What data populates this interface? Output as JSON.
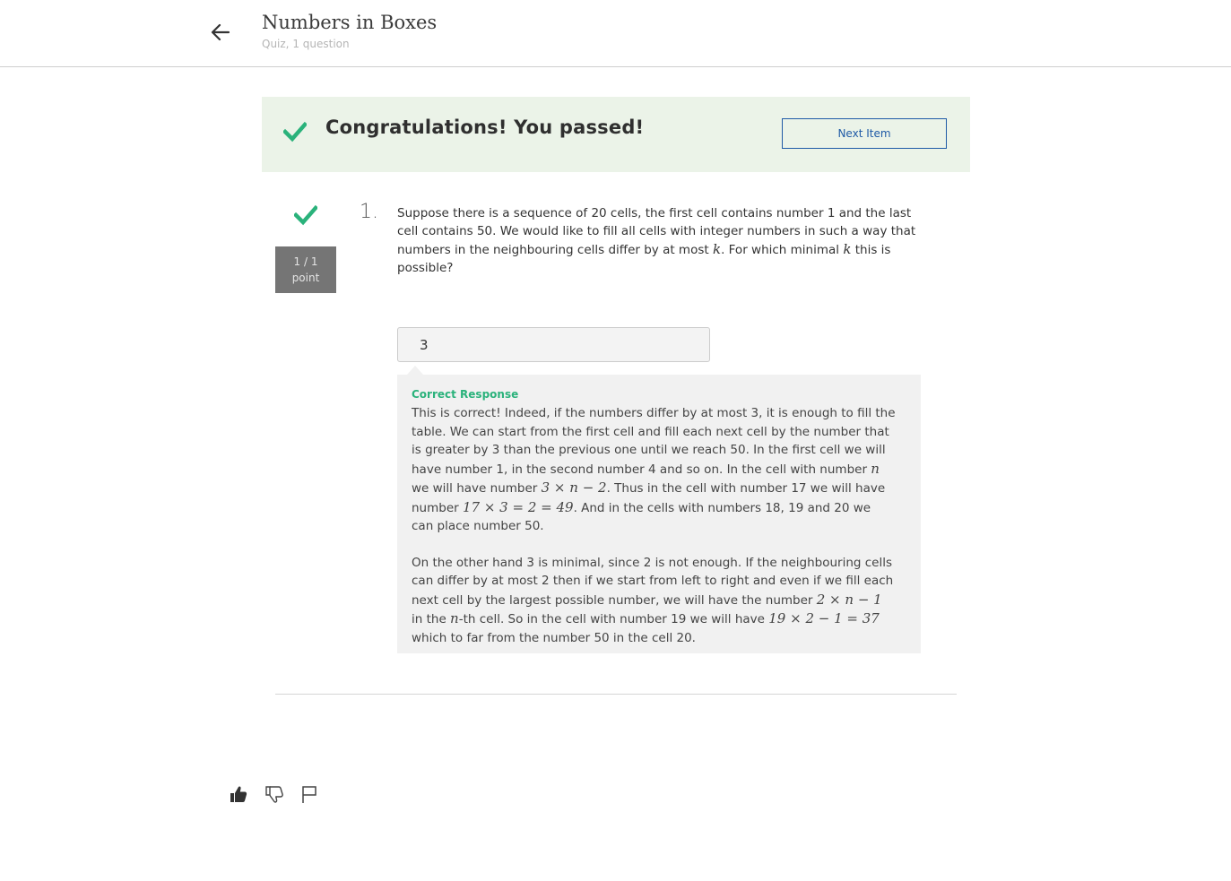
{
  "header": {
    "back_icon": "arrow-left-icon",
    "title": "Numbers in Boxes",
    "subtitle": "Quiz, 1 question"
  },
  "banner": {
    "icon": "check-icon",
    "message": "Congratulations! You passed!",
    "next_label": "Next Item",
    "background_color": "#ebf3e8",
    "check_color": "#2ab27b"
  },
  "question": {
    "status_icon": "check-icon",
    "points_score": "1 / 1",
    "points_unit": "point",
    "number": "1.",
    "text_part1": "Suppose there is a sequence of 20 cells, the first cell contains number 1 and the last cell contains 50. We would like to fill all cells with integer numbers in such a way that numbers in the neighbouring cells differ by at most ",
    "var_k": "k",
    "text_part2": ". For which minimal ",
    "text_part3": " this is possible?",
    "answer_value": "3"
  },
  "feedback": {
    "label": "Correct Response",
    "p1_a": "This is correct! Indeed, if the numbers differ by at most 3, it is enough to fill the table. We can start from the first cell and fill each next cell by the number that is greater by 3 than the previous one until we reach 50. In the first cell we will have number 1, in the second number 4 and so on. In the cell with number ",
    "p1_n": "n",
    "p1_b": " we will have number ",
    "p1_math1": "3 × n − 2",
    "p1_c": ". Thus in the cell with number 17 we will have number ",
    "p1_math2": "17 × 3 = 2 = 49",
    "p1_d": ". And in the cells with numbers 18, 19 and 20 we can place number 50.",
    "p2_a": "On the other hand 3 is minimal, since 2 is not enough. If the neighbouring cells can differ by at most 2 then if we start from left to right and even if we fill each next cell by the largest possible number, we will have the number ",
    "p2_math1": "2 × n − 1",
    "p2_b": " in the ",
    "p2_n": "n",
    "p2_c": "-th cell. So in the cell with number 19 we will have ",
    "p2_math2": "19 × 2 − 1 = 37",
    "p2_d": " which to far from the number 50 in the cell 20.",
    "accent_color": "#2ab27b"
  },
  "actions": {
    "like_icon": "thumbs-up-icon",
    "dislike_icon": "thumbs-down-icon",
    "flag_icon": "flag-icon"
  }
}
